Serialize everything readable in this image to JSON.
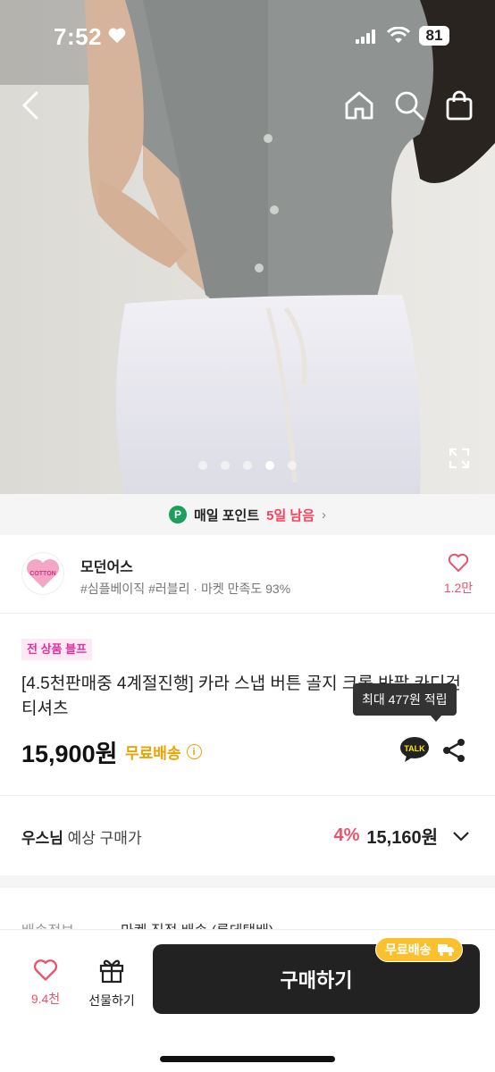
{
  "status_bar": {
    "time": "7:52",
    "battery": "81"
  },
  "hero": {
    "image_count": 5,
    "active_index": 3
  },
  "point_banner": {
    "badge": "P",
    "text": "매일 포인트",
    "days_left": "5일 남음"
  },
  "store": {
    "logo_text": "COTTON",
    "name": "모던어스",
    "tags": "#심플베이직 #러블리 · 마켓 만족도 93%",
    "like_count": "1.2만"
  },
  "product": {
    "badge": "전 상품 블프",
    "title": "[4.5천판매중 4계절진행] 카라 스냅 버튼 골지 크롭 반팔 카디건 티셔츠",
    "tooltip": "최대 477원 적립",
    "price": "15,900원",
    "free_shipping": "무료배송",
    "talk_label": "TALK"
  },
  "member_price": {
    "name": "우스님",
    "label": "예상 구매가",
    "discount": "4%",
    "price": "15,160원"
  },
  "delivery": {
    "key": "배송정보",
    "value": "마켓 직접 배송 (롯데택배)"
  },
  "bottom_bar": {
    "wish_count": "9.4천",
    "gift_label": "선물하기",
    "buy_label": "구매하기",
    "buy_badge": "무료배송"
  },
  "colors": {
    "accent_pink": "#e8546b",
    "free_ship": "#f0a100",
    "point_green": "#1aa05a"
  }
}
